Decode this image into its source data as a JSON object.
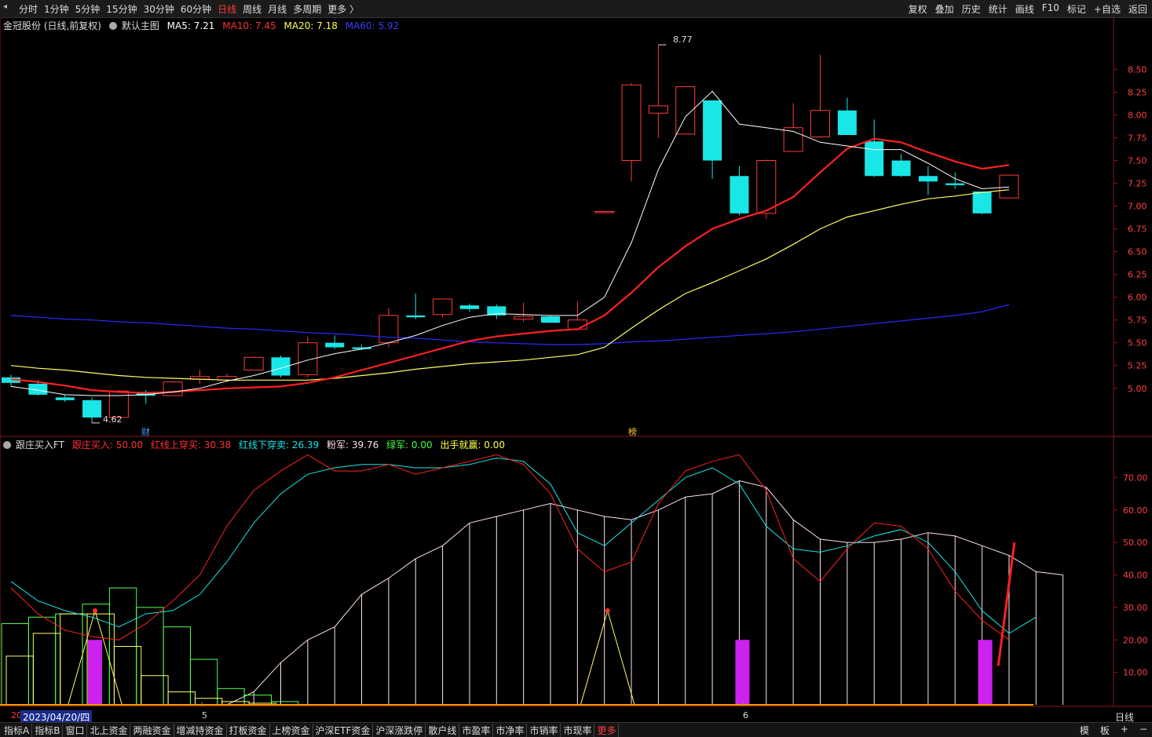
{
  "toolbar": {
    "periods": [
      "分时",
      "1分钟",
      "5分钟",
      "15分钟",
      "30分钟",
      "60分钟",
      "日线",
      "周线",
      "月线",
      "多周期",
      "更多 〉"
    ],
    "active_period": "日线",
    "tools": [
      "复权",
      "叠加",
      "历史",
      "统计",
      "画线",
      "F10",
      "标记",
      "+自选",
      "返回"
    ]
  },
  "main_header": {
    "stock": "金冠股份 (日线,前复权)",
    "template": "默认主图",
    "ma5": "MA5: 7.21",
    "ma10": "MA10: 7.45",
    "ma20": "MA20: 7.18",
    "ma60": "MA60: 5.92"
  },
  "sub_header": {
    "name": "跟庄买入FT",
    "buy": "跟庄买入: 50.00",
    "red_up": "红线上穿买: 30.38",
    "red_down": "红线下穿卖: 26.39",
    "pink": "粉军: 39.76",
    "green": "绿军: 0.00",
    "exit": "出手就赢: 0.00"
  },
  "annotations": {
    "high": "8.77",
    "low": "4.62",
    "cai": "财",
    "bang": "榜"
  },
  "xaxis": {
    "date_box": "2023/04/20/四",
    "month5": "5",
    "month6": "6",
    "period": "日线",
    "left_edge": "20"
  },
  "bottom_tabs": [
    "指标A",
    "指标B",
    "窗口",
    "北上资金",
    "两融资金",
    "增减持资金",
    "打板资金",
    "上榜资金",
    "沪深ETF资金",
    "沪深涨跌停",
    "散户线",
    "市盈率",
    "市净率",
    "市销率",
    "市现率",
    "更多"
  ],
  "bottom_right": [
    "模",
    "板",
    "+",
    "−"
  ],
  "colors": {
    "up": "#ff3b3b",
    "down": "#19e6e6",
    "ma5": "#ffffff",
    "ma10": "#ff2020",
    "ma20": "#ffff66",
    "ma60": "#2a2aff"
  },
  "chart_data": [
    {
      "type": "candlestick",
      "ylim": [
        4.55,
        8.9
      ],
      "yticks": [
        "8.50",
        "8.25",
        "8.00",
        "7.75",
        "7.50",
        "7.25",
        "7.00",
        "6.75",
        "6.50",
        "6.25",
        "6.00",
        "5.75",
        "5.50",
        "5.25",
        "5.00"
      ],
      "candles": [
        {
          "o": 5.12,
          "h": 5.15,
          "l": 5.02,
          "c": 5.06
        },
        {
          "o": 5.05,
          "h": 5.09,
          "l": 4.92,
          "c": 4.93
        },
        {
          "o": 4.9,
          "h": 4.93,
          "l": 4.85,
          "c": 4.87
        },
        {
          "o": 4.87,
          "h": 4.9,
          "l": 4.62,
          "c": 4.68
        },
        {
          "o": 4.68,
          "h": 4.98,
          "l": 4.68,
          "c": 4.97
        },
        {
          "o": 4.96,
          "h": 4.98,
          "l": 4.83,
          "c": 4.92
        },
        {
          "o": 4.92,
          "h": 5.08,
          "l": 4.92,
          "c": 5.07
        },
        {
          "o": 5.1,
          "h": 5.2,
          "l": 5.05,
          "c": 5.13
        },
        {
          "o": 5.09,
          "h": 5.16,
          "l": 5.07,
          "c": 5.13
        },
        {
          "o": 5.2,
          "h": 5.35,
          "l": 5.2,
          "c": 5.34
        },
        {
          "o": 5.34,
          "h": 5.36,
          "l": 5.12,
          "c": 5.14
        },
        {
          "o": 5.15,
          "h": 5.57,
          "l": 5.12,
          "c": 5.5
        },
        {
          "o": 5.5,
          "h": 5.58,
          "l": 5.43,
          "c": 5.45
        },
        {
          "o": 5.45,
          "h": 5.48,
          "l": 5.42,
          "c": 5.43
        },
        {
          "o": 5.5,
          "h": 5.88,
          "l": 5.45,
          "c": 5.8
        },
        {
          "o": 5.8,
          "h": 6.04,
          "l": 5.76,
          "c": 5.78
        },
        {
          "o": 5.81,
          "h": 5.98,
          "l": 5.78,
          "c": 5.98
        },
        {
          "o": 5.91,
          "h": 5.93,
          "l": 5.84,
          "c": 5.87
        },
        {
          "o": 5.9,
          "h": 5.92,
          "l": 5.76,
          "c": 5.8
        },
        {
          "o": 5.76,
          "h": 5.94,
          "l": 5.73,
          "c": 5.79
        },
        {
          "o": 5.79,
          "h": 5.8,
          "l": 5.72,
          "c": 5.72
        },
        {
          "o": 5.65,
          "h": 5.95,
          "l": 5.63,
          "c": 5.75
        },
        {
          "o": 6.94,
          "h": 6.94,
          "l": 6.94,
          "c": 6.94
        },
        {
          "o": 7.5,
          "h": 8.35,
          "l": 7.27,
          "c": 8.33
        },
        {
          "o": 8.02,
          "h": 8.77,
          "l": 7.75,
          "c": 8.1
        },
        {
          "o": 7.79,
          "h": 8.31,
          "l": 7.8,
          "c": 8.31
        },
        {
          "o": 8.16,
          "h": 8.16,
          "l": 7.3,
          "c": 7.5
        },
        {
          "o": 7.33,
          "h": 7.44,
          "l": 6.9,
          "c": 6.92
        },
        {
          "o": 6.92,
          "h": 7.51,
          "l": 6.86,
          "c": 7.5
        },
        {
          "o": 7.6,
          "h": 8.13,
          "l": 7.6,
          "c": 7.86
        },
        {
          "o": 7.76,
          "h": 8.66,
          "l": 7.75,
          "c": 8.05
        },
        {
          "o": 8.05,
          "h": 8.19,
          "l": 7.78,
          "c": 7.78
        },
        {
          "o": 7.71,
          "h": 7.95,
          "l": 7.32,
          "c": 7.33
        },
        {
          "o": 7.5,
          "h": 7.57,
          "l": 7.32,
          "c": 7.33
        },
        {
          "o": 7.33,
          "h": 7.44,
          "l": 7.12,
          "c": 7.27
        },
        {
          "o": 7.25,
          "h": 7.37,
          "l": 7.19,
          "c": 7.23
        },
        {
          "o": 7.16,
          "h": 7.16,
          "l": 6.91,
          "c": 6.92
        },
        {
          "o": 7.09,
          "h": 7.34,
          "l": 7.09,
          "c": 7.34
        }
      ],
      "ma5": [
        5.02,
        4.98,
        4.93,
        4.92,
        4.92,
        4.93,
        4.96,
        5.0,
        5.08,
        5.14,
        5.22,
        5.31,
        5.38,
        5.43,
        5.5,
        5.58,
        5.69,
        5.78,
        5.82,
        5.81,
        5.8,
        5.8,
        6.0,
        6.6,
        7.4,
        7.98,
        8.26,
        7.9,
        7.86,
        7.82,
        7.7,
        7.66,
        7.62,
        7.62,
        7.47,
        7.3,
        7.19,
        7.21
      ],
      "ma10": [
        5.1,
        5.07,
        5.03,
        4.98,
        4.96,
        4.95,
        4.96,
        4.98,
        5.0,
        5.01,
        5.02,
        5.06,
        5.12,
        5.2,
        5.28,
        5.36,
        5.44,
        5.52,
        5.57,
        5.6,
        5.63,
        5.65,
        5.8,
        6.05,
        6.33,
        6.56,
        6.75,
        6.86,
        6.95,
        7.1,
        7.37,
        7.63,
        7.74,
        7.7,
        7.59,
        7.49,
        7.41,
        7.45
      ],
      "ma20": [
        5.25,
        5.22,
        5.2,
        5.17,
        5.14,
        5.12,
        5.11,
        5.1,
        5.09,
        5.09,
        5.09,
        5.09,
        5.11,
        5.14,
        5.17,
        5.21,
        5.24,
        5.27,
        5.29,
        5.31,
        5.34,
        5.37,
        5.45,
        5.66,
        5.86,
        6.04,
        6.16,
        6.29,
        6.42,
        6.58,
        6.75,
        6.88,
        6.95,
        7.02,
        7.08,
        7.11,
        7.15,
        7.18
      ],
      "ma60": [
        5.8,
        5.78,
        5.76,
        5.75,
        5.73,
        5.72,
        5.7,
        5.68,
        5.66,
        5.65,
        5.63,
        5.61,
        5.6,
        5.58,
        5.56,
        5.55,
        5.53,
        5.51,
        5.5,
        5.49,
        5.48,
        5.48,
        5.49,
        5.51,
        5.52,
        5.54,
        5.56,
        5.58,
        5.6,
        5.62,
        5.65,
        5.68,
        5.71,
        5.74,
        5.77,
        5.8,
        5.84,
        5.92
      ]
    },
    {
      "type": "line",
      "ylim": [
        0,
        80
      ],
      "yticks": [
        "70.00",
        "60.00",
        "50.00",
        "40.00",
        "30.00",
        "20.00",
        "10.00"
      ],
      "series": [
        {
          "name": "跟庄买入",
          "color": "#ff2020",
          "values": [
            36,
            28,
            23,
            21,
            20,
            25,
            32,
            40,
            55,
            66,
            72,
            77,
            72,
            72,
            74,
            71,
            73,
            75,
            77,
            74,
            65,
            48,
            41,
            44,
            62,
            72,
            75,
            77,
            66,
            45,
            38,
            48,
            56,
            55,
            48,
            35,
            26,
            20,
            18,
            50
          ]
        },
        {
          "name": "红线下穿卖",
          "color": "#19e6e6",
          "values": [
            38,
            32,
            29,
            27,
            24,
            28,
            29,
            34,
            44,
            56,
            65,
            71,
            73,
            74,
            74,
            73,
            73,
            74,
            76,
            75,
            68,
            53,
            49,
            56,
            63,
            70,
            73,
            68,
            55,
            48,
            47,
            49,
            52,
            54,
            50,
            41,
            29,
            22,
            27
          ]
        },
        {
          "name": "粉军",
          "color": "#ffddee",
          "values": [
            0,
            0,
            0,
            0,
            0,
            0,
            0,
            0,
            0,
            0,
            4,
            13,
            20,
            24,
            34,
            39,
            45,
            49,
            56,
            58,
            60,
            62,
            60,
            58,
            57,
            60,
            64,
            65,
            69,
            67,
            57,
            51,
            50,
            50,
            51,
            53,
            52,
            49,
            46,
            41,
            40
          ]
        },
        {
          "name": "绿军",
          "color": "#66ff66",
          "values": [
            25,
            27,
            28,
            31,
            36,
            30,
            24,
            14,
            5,
            3,
            1,
            0,
            0,
            0,
            0,
            0,
            0,
            0,
            0,
            0,
            0,
            0,
            0,
            0,
            0,
            0,
            0,
            0,
            0,
            0,
            0,
            0,
            0,
            0,
            0,
            0,
            0,
            0,
            0
          ]
        },
        {
          "name": "出手就赢",
          "color": "#ffff66",
          "values": [
            0,
            0,
            0,
            29,
            0,
            0,
            0,
            0,
            0,
            0,
            0,
            0,
            0,
            0,
            0,
            0,
            0,
            0,
            0,
            0,
            0,
            0,
            29,
            0,
            0,
            0,
            0,
            0,
            0,
            0,
            0,
            0,
            0,
            0,
            0,
            0,
            0,
            0
          ]
        }
      ],
      "bars_magenta": [
        {
          "index": 3,
          "value": 20
        },
        {
          "index": 27,
          "value": 20
        },
        {
          "index": 36,
          "value": 20
        }
      ]
    }
  ]
}
